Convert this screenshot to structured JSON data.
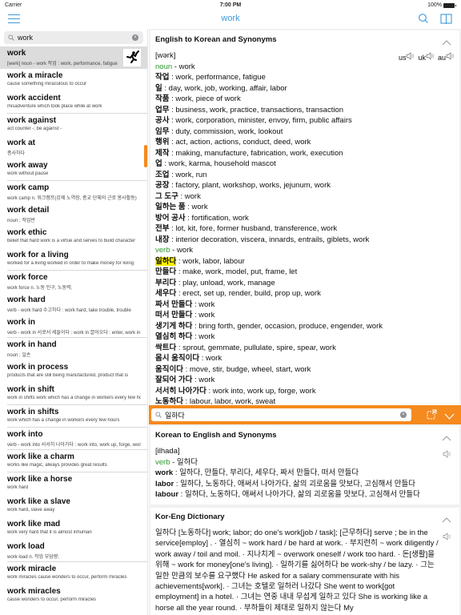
{
  "status_bar": {
    "carrier": "Carrier",
    "time": "7:00 PM",
    "battery": "100%"
  },
  "nav": {
    "title": "work",
    "icons": [
      "menu-icon",
      "search-icon",
      "book-icon"
    ]
  },
  "sidebar": {
    "search": {
      "value": "work",
      "placeholder": ""
    },
    "entries": [
      {
        "word": "work",
        "desc": "[wərk] noun - work 작업 : work, performance, fatigue",
        "selected": true
      },
      {
        "word": "work a miracle",
        "desc": "cause something miraculous to occur"
      },
      {
        "word": "work accident",
        "desc": "misadventure which took place while at work"
      },
      {
        "word": "work against",
        "desc": "act counter -; be against -"
      },
      {
        "word": "work at",
        "desc": "종사하다"
      },
      {
        "word": "work away",
        "desc": "work without pause"
      },
      {
        "word": "work camp",
        "desc": "work camp  n. 워크캠프(강제 노역장, 종교 단체의 근로 봉사활동)"
      },
      {
        "word": "work detail",
        "desc": "noun ; 작업반"
      },
      {
        "word": "work ethic",
        "desc": "belief that hard work is a virtue and serves to build character"
      },
      {
        "word": "work for a living",
        "desc": "worked for a living worked in order to make money for living"
      },
      {
        "word": "work force",
        "desc": "work force  n. 노동 인구, 노동력;"
      },
      {
        "word": "work hard",
        "desc": "verb  - work hard 수고하다 : work hard, take trouble, trouble"
      },
      {
        "word": "work in",
        "desc": "verb  - work in 서로서 세들이다 : work in 끌어오다 : enter, work in"
      },
      {
        "word": "work in hand",
        "desc": "noun ; 일손"
      },
      {
        "word": "work in process",
        "desc": "products that are still being manufactured, product that is"
      },
      {
        "word": "work in shift",
        "desc": "work in shifts work which has a change in workers every few hours"
      },
      {
        "word": "work in shifts",
        "desc": "work which has a change in workers every few hours"
      },
      {
        "word": "work into",
        "desc": "verb  - work into 서서히 나아가다 : work into, work up, forge, work"
      },
      {
        "word": "work like a charm",
        "desc": "works like magic, always provides great results"
      },
      {
        "word": "work like a horse",
        "desc": "work hard"
      },
      {
        "word": "work like a slave",
        "desc": "work hard, slave away"
      },
      {
        "word": "work like mad",
        "desc": "work very hard that it is almost inhuman"
      },
      {
        "word": "work load",
        "desc": "work load  n. 작업 부담량;"
      },
      {
        "word": "work miracle",
        "desc": "work miracles cause wonders to occur, perform miracles"
      },
      {
        "word": "work miracles",
        "desc": "cause wonders to occur, perform miracles"
      }
    ]
  },
  "eng_kor": {
    "title": "English to Korean and Synonyms",
    "pronunciation": "[wərk]",
    "audio_labels": [
      "us",
      "uk",
      "au"
    ],
    "noun_label": "noun",
    "noun_word": " - work",
    "noun_defs": [
      {
        "ko": "작업",
        "en": " : work, performance, fatigue"
      },
      {
        "ko": "일",
        "en": " : day, work, job, working, affair, labor"
      },
      {
        "ko": "작품",
        "en": " : work, piece of work"
      },
      {
        "ko": "업무",
        "en": " : business, work, practice, transactions, transaction"
      },
      {
        "ko": "공사",
        "en": " : work, corporation, minister, envoy, firm, public affairs"
      },
      {
        "ko": "임무",
        "en": " : duty, commission, work, lookout"
      },
      {
        "ko": "행위",
        "en": " : act, action, actions, conduct, deed, work"
      },
      {
        "ko": "제작",
        "en": " : making, manufacture, fabrication, work, execution"
      },
      {
        "ko": "업",
        "en": " : work, karma, household mascot"
      },
      {
        "ko": "조업",
        "en": " : work, run"
      },
      {
        "ko": "공장",
        "en": " : factory, plant, workshop, works, jejunum, work"
      },
      {
        "ko": "그 도구",
        "en": " : work"
      },
      {
        "ko": "일하는 품",
        "en": " : work"
      },
      {
        "ko": "방어 공사",
        "en": " : fortification, work"
      },
      {
        "ko": "전부",
        "en": " : lot, kit, fore, former husband, transference, work"
      },
      {
        "ko": "내장",
        "en": " : interior decoration, viscera, innards, entrails, giblets, work"
      }
    ],
    "verb_label": "verb",
    "verb_word": " - work",
    "verb_defs": [
      {
        "ko": "일하다",
        "en": " : work, labor, labour",
        "highlight": true
      },
      {
        "ko": "만들다",
        "en": " : make, work, model, put, frame, let"
      },
      {
        "ko": "부리다",
        "en": " : play, unload, work, manage"
      },
      {
        "ko": "세우다",
        "en": " : erect, set up, render, build, prop up, work"
      },
      {
        "ko": "짜서 만들다",
        "en": " : work"
      },
      {
        "ko": "떠서 만들다",
        "en": " : work"
      },
      {
        "ko": "생기게 하다",
        "en": " : bring forth, gender, occasion, produce, engender, work"
      },
      {
        "ko": "열심히 하다",
        "en": " : work"
      },
      {
        "ko": "싹트다",
        "en": " : sprout, gemmate, pullulate, spire, spear, work"
      },
      {
        "ko": "몸시 움직이다",
        "en": " : work"
      },
      {
        "ko": "움직이다",
        "en": " : move, stir, budge, wheel, start, work"
      },
      {
        "ko": "잘되어 가다",
        "en": " : work"
      },
      {
        "ko": "서서히 나아가다",
        "en": " : work into, work up, forge, work"
      },
      {
        "ko": "노동하다",
        "en": " : labour, labor, work, sweat"
      }
    ]
  },
  "lookup_bar": {
    "value": "일하다",
    "placeholder": ""
  },
  "kor_eng": {
    "title": "Korean to English and Synonyms",
    "pronunciation": "[ilhada]",
    "verb_label": "verb",
    "verb_word": " - 일하다",
    "defs": [
      {
        "en": "work",
        "ko": " : 일하다, 만들다, 부리다, 세우다, 짜서 만들다, 떠서 만들다"
      },
      {
        "en": "labor",
        "ko": " : 일하다, 노동하다, 애써서 나아가다, 삶의 괴로움을 맛보다, 고심해서 만들다"
      },
      {
        "en": "labour",
        "ko": " : 일하다, 노동하다, 애써서 나아가다, 삶의 괴로움을 맛보다, 고심해서 만들다"
      }
    ]
  },
  "kor_eng_dict": {
    "title": "Kor-Eng Dictionary",
    "text": "일하다 [노동하다] work; labor; do one's work[job / task]; [근무하다] serve ; be in the service[employ] . · 열심히 ~ work hard / be hard at work. · 부지런히 ~ work diligently / work away / toil and moil. · 지나치게 ~ overwork oneself / work too hard. · 돈[생활]을 위해 ~ work for money[one's living]. · 일하기를 싫어하다 be work-shy / be lazy. · 그는 일한 만큼의 보수를 요구했다 He asked for a salary commensurate with his achievements[work]. · 그녀는 호텔로 일하러 나갔다 She went to work[got employment] in a hotel. · 그녀는 연중 내내 무섭게 일하고 있다 She is working like a horse all the year round. · 부하들이 제대로 일하지 않는다 My"
  },
  "colors": {
    "accent": "#3f9ad8",
    "orange": "#f58a1e",
    "pos_green": "#2e9a2e",
    "highlight": "#f8f000"
  }
}
